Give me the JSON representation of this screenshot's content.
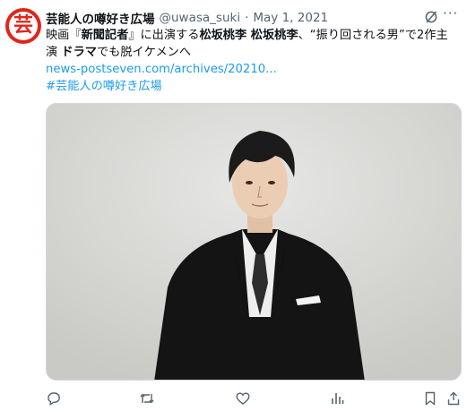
{
  "tweet": {
    "avatar_glyph": "芸",
    "author_name": "芸能人の噂好き広場",
    "handle": "@uwasa_suki",
    "separator": "·",
    "date": "May 1, 2021",
    "more_label": "···",
    "text": {
      "l1a": "映画『",
      "l1b": "新聞記者",
      "l1c": "』に出演する",
      "l1d": "松坂桃李 松坂桃李",
      "l1e": "、“振り回される男”で2作主",
      "l2a": "演 ",
      "l2b": "ドラマ",
      "l2c": "でも脱イケメンへ",
      "link": "news-postseven.com/archives/20210...",
      "hashtag": "#芸能人の噂好き広場"
    }
  },
  "icons": {
    "grok": "grok-icon",
    "reply": "reply-icon",
    "retweet": "retweet-icon",
    "like": "like-icon",
    "views": "views-icon",
    "bookmark": "bookmark-icon",
    "share": "share-icon"
  },
  "colors": {
    "accent": "#1d9bf0",
    "avatar": "#e2241b",
    "muted": "#536471"
  }
}
